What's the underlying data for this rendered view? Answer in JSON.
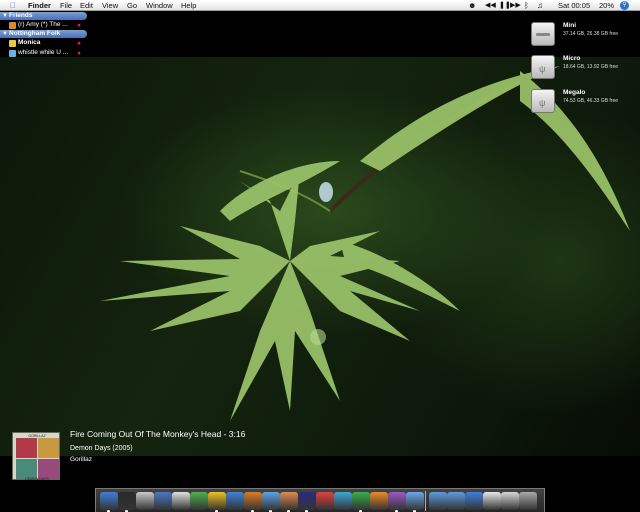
{
  "menubar": {
    "items": [
      "Finder",
      "File",
      "Edit",
      "View",
      "Go",
      "Window",
      "Help"
    ],
    "clock": "Sat 00:05",
    "battery": "20%"
  },
  "buddylist": {
    "groups": [
      {
        "name": "Friends",
        "buddies": [
          {
            "name": "(r) Amy (*) The ...",
            "status_color": "#e22222"
          }
        ]
      },
      {
        "name": "Nottingham Folk",
        "buddies": [
          {
            "name": "Monica",
            "status_color": "#e22222"
          },
          {
            "name": "whistle while U ...",
            "status_color": "#e22222"
          }
        ]
      }
    ]
  },
  "disks": [
    {
      "name": "Mini",
      "info": "37.14 GB, 26.38 GB free"
    },
    {
      "name": "Micro",
      "info": "18.64 GB, 13.92 GB free"
    },
    {
      "name": "Megalo",
      "info": "74.53 GB, 46.33 GB free"
    }
  ],
  "now_playing": {
    "title": "Fire Coming Out Of The Monkey's Head - 3:16",
    "album": "Demon Days (2005)",
    "artist": "Gorillaz",
    "cover_labels": [
      "GORILLAZ",
      "DEMON DAYS"
    ]
  },
  "dock": {
    "apps": [
      {
        "name": "finder-icon",
        "color": "#3d7fe0"
      },
      {
        "name": "dashboard-icon",
        "color": "#2a2a2a"
      },
      {
        "name": "mail-icon",
        "color": "#c8c8c8"
      },
      {
        "name": "iphoto-icon",
        "color": "#4a78c8"
      },
      {
        "name": "ipod-icon",
        "color": "#e0e0e0"
      },
      {
        "name": "recycle-icon",
        "color": "#4db04d"
      },
      {
        "name": "adium-duck-icon",
        "color": "#f2c21a"
      },
      {
        "name": "network-icon",
        "color": "#3f82d8"
      },
      {
        "name": "firefox-icon",
        "color": "#e07a20"
      },
      {
        "name": "itunes-icon",
        "color": "#58a3e8"
      },
      {
        "name": "camino-icon",
        "color": "#e08a4a"
      },
      {
        "name": "star-icon",
        "color": "#2b2b80"
      },
      {
        "name": "flag-icon",
        "color": "#e34040"
      },
      {
        "name": "u-icon",
        "color": "#38a8d8"
      },
      {
        "name": "green-tool-icon",
        "color": "#38b048"
      },
      {
        "name": "p-icon",
        "color": "#f08a20"
      },
      {
        "name": "purple-app-icon",
        "color": "#9a58c8"
      },
      {
        "name": "ichat-icon",
        "color": "#6aa8f0"
      },
      {
        "name": "documents-folder-icon",
        "color": "#5b9be0"
      },
      {
        "name": "applications-folder-icon",
        "color": "#5b9be0"
      },
      {
        "name": "downloads-icon",
        "color": "#3d7fe0"
      },
      {
        "name": "document-icon",
        "color": "#e8e8e8"
      },
      {
        "name": "image-stack-icon",
        "color": "#d8d8d8"
      },
      {
        "name": "trash-icon",
        "color": "#a8a8a8"
      }
    ]
  }
}
